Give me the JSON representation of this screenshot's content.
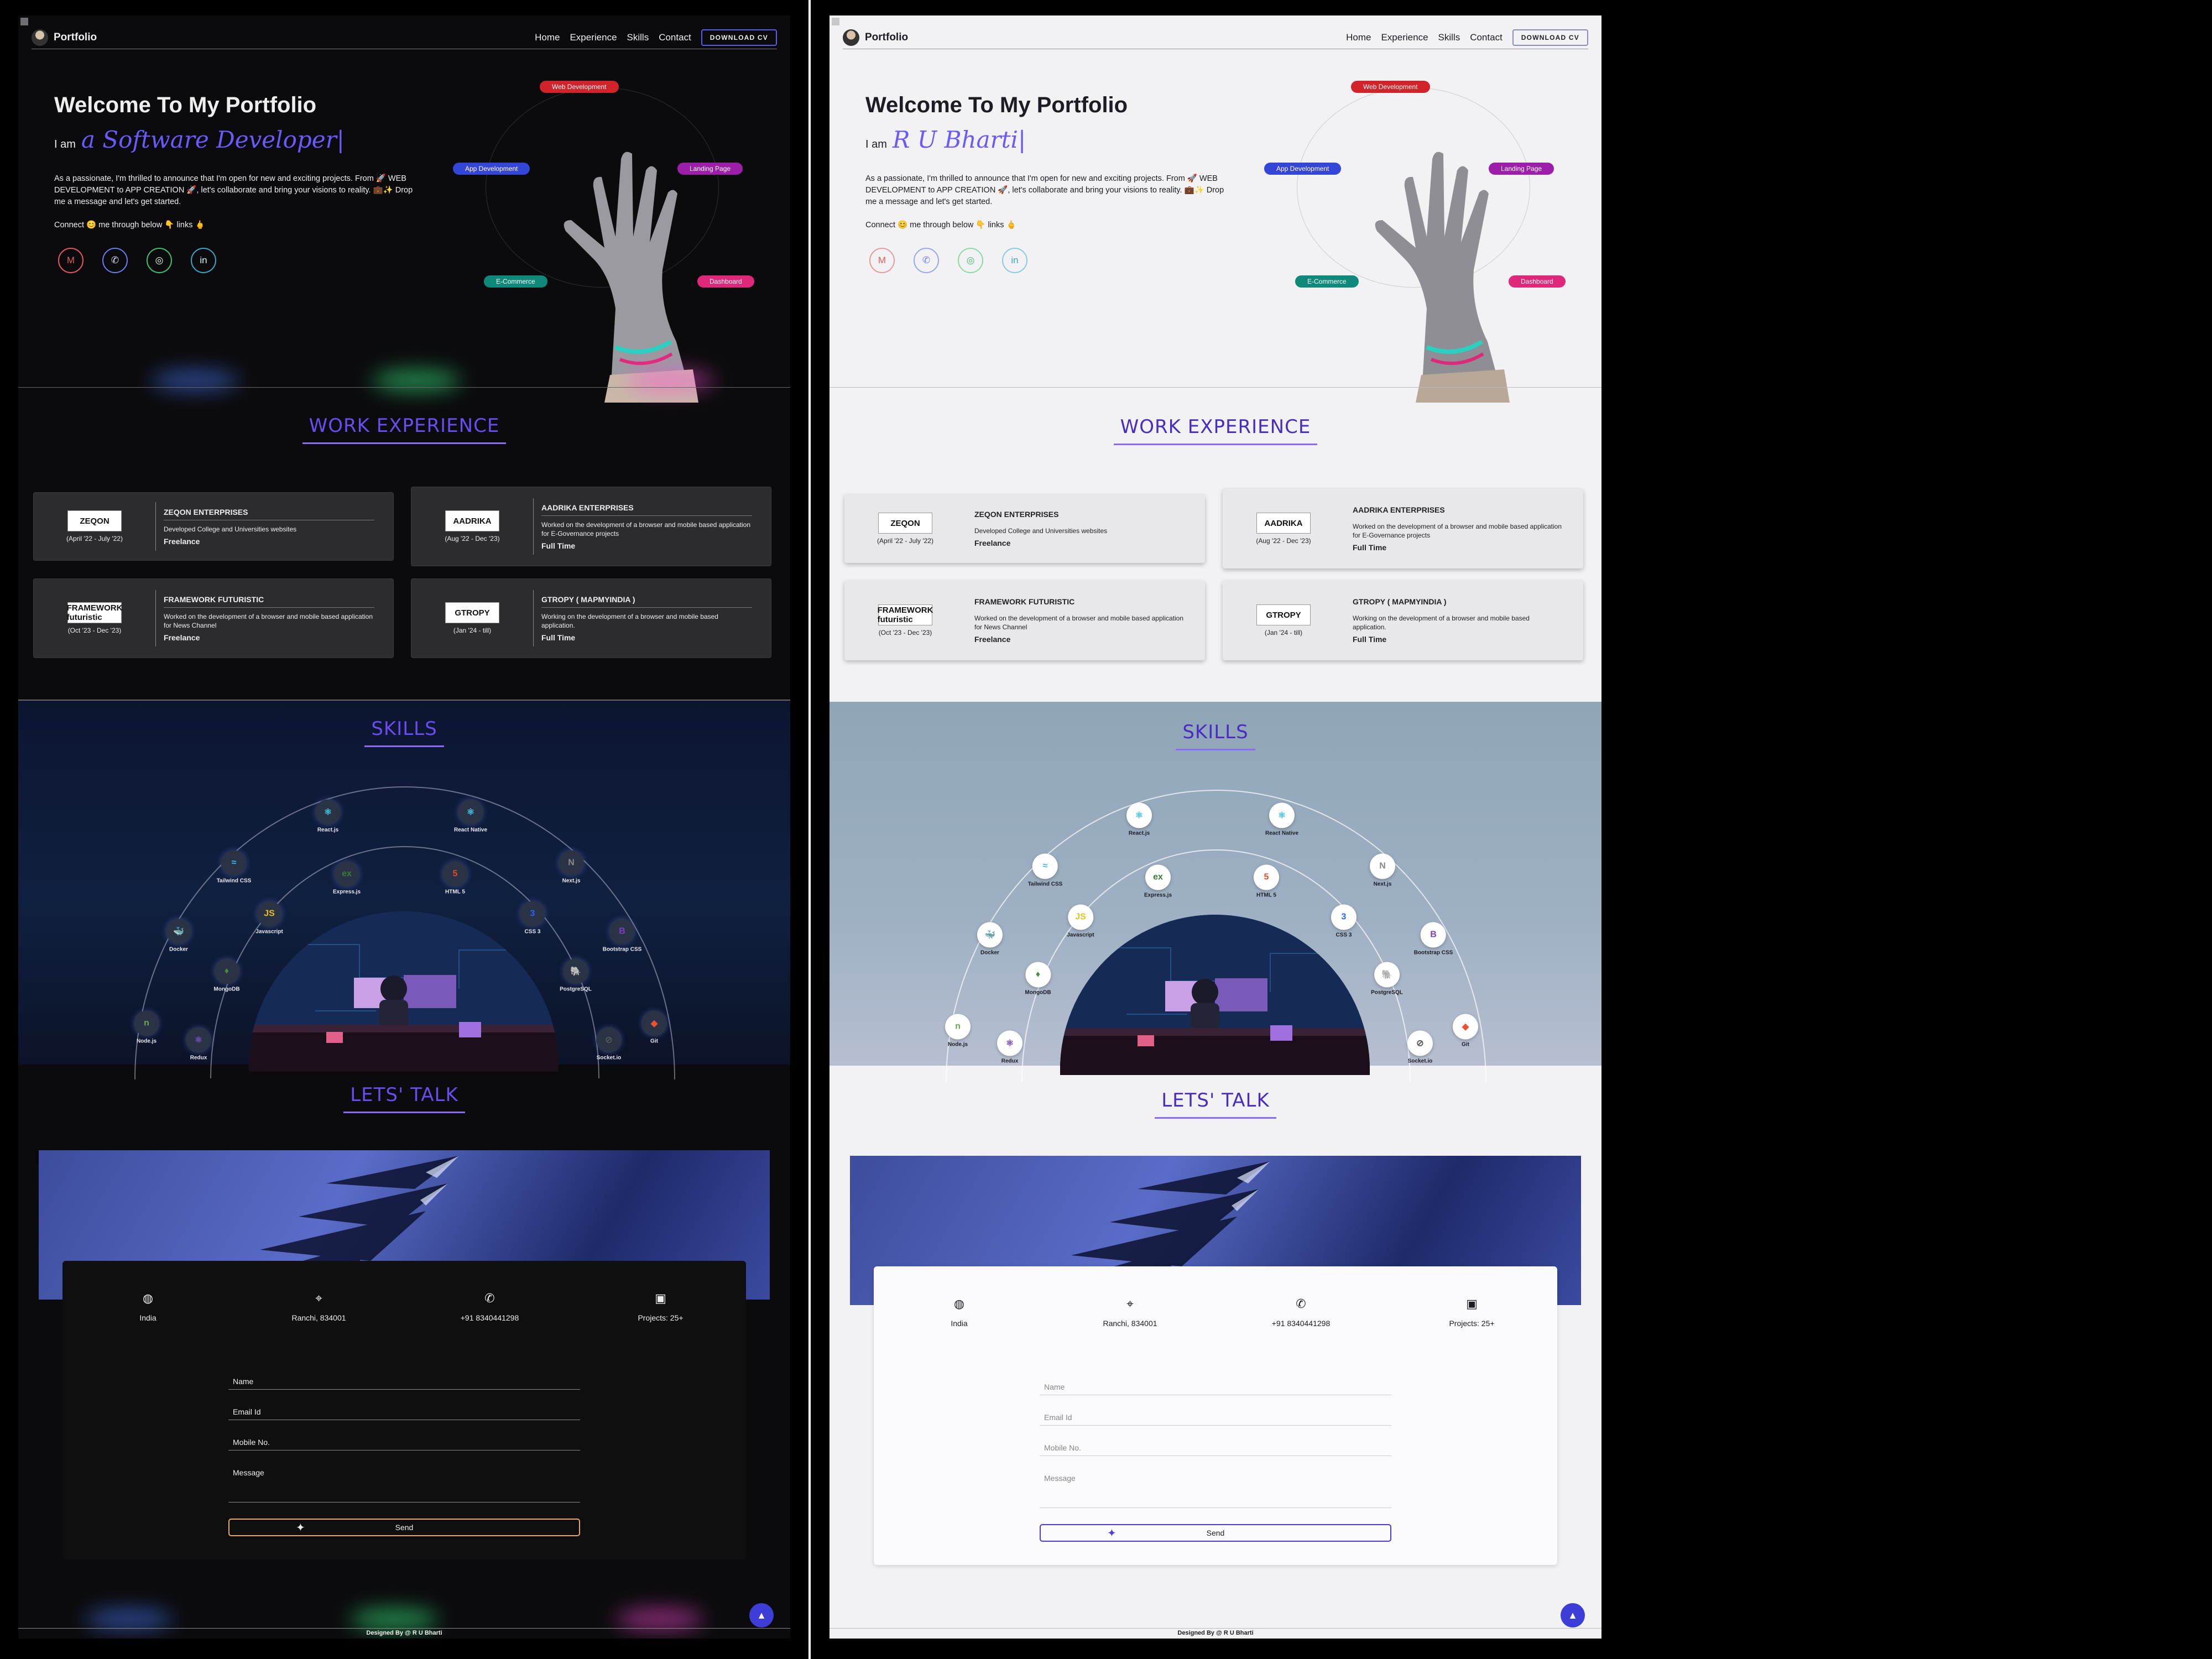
{
  "nav": {
    "brand": "Portfolio",
    "links": [
      "Home",
      "Experience",
      "Skills",
      "Contact"
    ],
    "download_cv": "DOWNLOAD CV"
  },
  "hero": {
    "title": "Welcome To My Portfolio",
    "i_am": "I am",
    "role_dark": "a Software Developer|",
    "role_light": "R U Bharti|",
    "description": "As a passionate, I'm thrilled to announce that I'm open for new and exciting projects. From 🚀 WEB DEVELOPMENT to APP CREATION 🚀, let's collaborate and bring your visions to reality. 💼✨ Drop me a message and let's get started.",
    "connect": "Connect 😊 me through below 👇 links 🖕",
    "socials": [
      {
        "icon": "gmail-icon",
        "glyph": "M",
        "color": "#e25b5b"
      },
      {
        "icon": "phone-icon",
        "glyph": "✆",
        "color": "#6a7cf0"
      },
      {
        "icon": "whatsapp-icon",
        "glyph": "◎",
        "color": "#3fbf6a"
      },
      {
        "icon": "linkedin-icon",
        "glyph": "in",
        "color": "#3aa5c8"
      }
    ],
    "chips": [
      {
        "label": "Web Development",
        "color": "#d2232a"
      },
      {
        "label": "App Development",
        "color": "#3346d8"
      },
      {
        "label": "Landing Page",
        "color": "#9b1fa8"
      },
      {
        "label": "E-Commerce",
        "color": "#0f8a7a"
      },
      {
        "label": "Dashboard",
        "color": "#e0287a"
      }
    ]
  },
  "experience": {
    "title": "WORK EXPERIENCE",
    "items": [
      {
        "logo": "ZEQON",
        "company": "ZEQON ENTERPRISES",
        "period": "(April '22 - July '22)",
        "desc": "Developed College and Universities websites",
        "type": "Freelance"
      },
      {
        "logo": "AADRIKA",
        "company": "AADRIKA ENTERPRISES",
        "period": "(Aug '22 - Dec '23)",
        "desc": "Worked on the development of a browser and mobile based application for E-Governance projects",
        "type": "Full Time"
      },
      {
        "logo": "FRAMEWORK futuristic",
        "company": "FRAMEWORK FUTURISTIC",
        "period": "(Oct '23 - Dec '23)",
        "desc": "Worked on the development of a browser and mobile based application for News Channel",
        "type": "Freelance"
      },
      {
        "logo": "GTROPY",
        "company": "GTROPY ( MAPMYINDIA )",
        "period": "(Jan '24 - till)",
        "desc": "Working on the development of a browser and mobile based application.",
        "type": "Full Time"
      }
    ]
  },
  "skills": {
    "title": "SKILLS",
    "items": [
      {
        "name": "React.js",
        "glyph": "⚛",
        "color": "#3fc4e0"
      },
      {
        "name": "React Native",
        "glyph": "⚛",
        "color": "#3fc4e0"
      },
      {
        "name": "Tailwind CSS",
        "glyph": "≈",
        "color": "#38bdf8"
      },
      {
        "name": "Express.js",
        "glyph": "ex",
        "color": "#3a7a3a"
      },
      {
        "name": "HTML 5",
        "glyph": "5",
        "color": "#e34c26"
      },
      {
        "name": "Next.js",
        "glyph": "N",
        "color": "#888"
      },
      {
        "name": "Javascript",
        "glyph": "JS",
        "color": "#e8c11c"
      },
      {
        "name": "CSS 3",
        "glyph": "3",
        "color": "#2965f1"
      },
      {
        "name": "Docker",
        "glyph": "🐳",
        "color": "#2496ed"
      },
      {
        "name": "Bootstrap CSS",
        "glyph": "B",
        "color": "#7a3ec8"
      },
      {
        "name": "MongoDB",
        "glyph": "♦",
        "color": "#4a8a3a"
      },
      {
        "name": "PostgreSQL",
        "glyph": "🐘",
        "color": "#336791"
      },
      {
        "name": "Node.js",
        "glyph": "n",
        "color": "#6aa84f"
      },
      {
        "name": "Socket.io",
        "glyph": "⊘",
        "color": "#555"
      },
      {
        "name": "Redux",
        "glyph": "⚛",
        "color": "#764abc"
      },
      {
        "name": "Git",
        "glyph": "◆",
        "color": "#f05032"
      }
    ]
  },
  "contact": {
    "title": "LETS' TALK",
    "info": [
      {
        "icon": "globe-icon",
        "glyph": "◍",
        "label": "India"
      },
      {
        "icon": "location-pin-icon",
        "glyph": "⌖",
        "label": "Ranchi, 834001"
      },
      {
        "icon": "phone-icon",
        "glyph": "✆",
        "label": "+91 8340441298"
      },
      {
        "icon": "projects-icon",
        "glyph": "▣",
        "label": "Projects: 25+"
      }
    ],
    "fields": {
      "name": "Name",
      "email": "Email Id",
      "mobile": "Mobile No.",
      "message": "Message"
    },
    "send": "Send"
  },
  "footer": "Designed By @ R U Bharti",
  "theme": {
    "accent": "#6a4cf0",
    "dark_bg": "#0b0b0d",
    "light_bg": "#f2f2f5"
  }
}
